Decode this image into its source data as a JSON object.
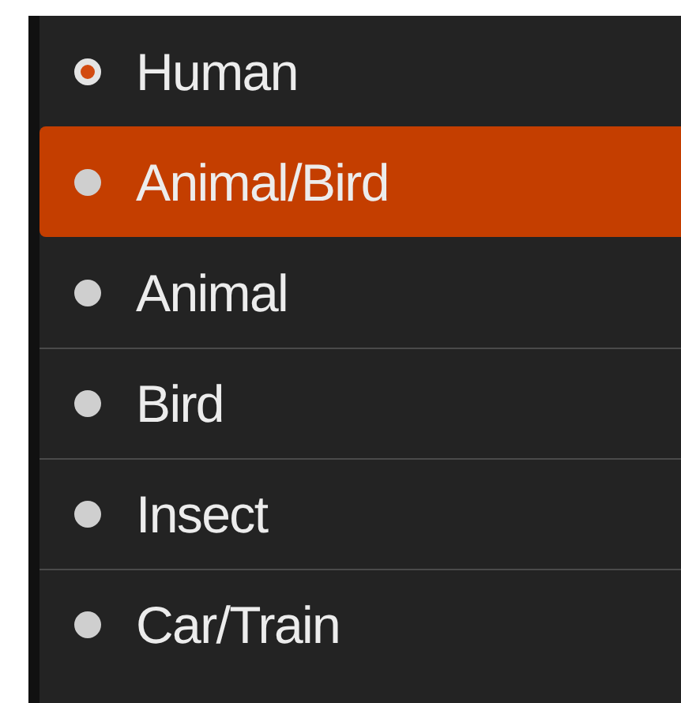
{
  "menu": {
    "items": [
      {
        "label": "Human",
        "selected": true,
        "focused": false
      },
      {
        "label": "Animal/Bird",
        "selected": false,
        "focused": true
      },
      {
        "label": "Animal",
        "selected": false,
        "focused": false
      },
      {
        "label": "Bird",
        "selected": false,
        "focused": false
      },
      {
        "label": "Insect",
        "selected": false,
        "focused": false
      },
      {
        "label": "Car/Train",
        "selected": false,
        "focused": false
      }
    ]
  }
}
